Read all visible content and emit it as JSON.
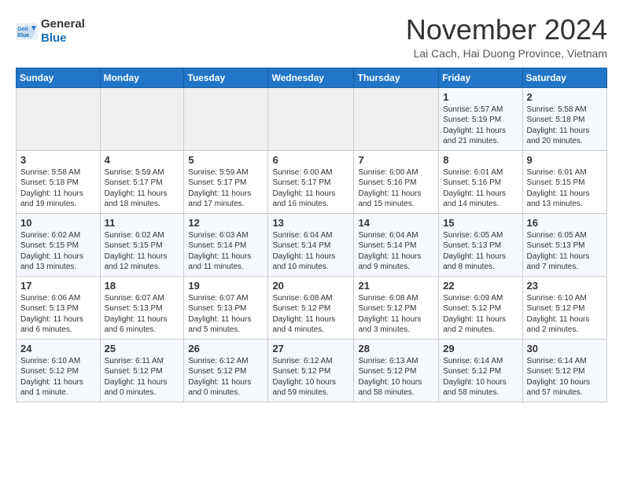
{
  "header": {
    "logo_general": "General",
    "logo_blue": "Blue",
    "month_title": "November 2024",
    "location": "Lai Cach, Hai Duong Province, Vietnam"
  },
  "weekdays": [
    "Sunday",
    "Monday",
    "Tuesday",
    "Wednesday",
    "Thursday",
    "Friday",
    "Saturday"
  ],
  "weeks": [
    [
      {
        "day": "",
        "info": ""
      },
      {
        "day": "",
        "info": ""
      },
      {
        "day": "",
        "info": ""
      },
      {
        "day": "",
        "info": ""
      },
      {
        "day": "",
        "info": ""
      },
      {
        "day": "1",
        "info": "Sunrise: 5:57 AM\nSunset: 5:19 PM\nDaylight: 11 hours\nand 21 minutes."
      },
      {
        "day": "2",
        "info": "Sunrise: 5:58 AM\nSunset: 5:18 PM\nDaylight: 11 hours\nand 20 minutes."
      }
    ],
    [
      {
        "day": "3",
        "info": "Sunrise: 5:58 AM\nSunset: 5:18 PM\nDaylight: 11 hours\nand 19 minutes."
      },
      {
        "day": "4",
        "info": "Sunrise: 5:59 AM\nSunset: 5:17 PM\nDaylight: 11 hours\nand 18 minutes."
      },
      {
        "day": "5",
        "info": "Sunrise: 5:59 AM\nSunset: 5:17 PM\nDaylight: 11 hours\nand 17 minutes."
      },
      {
        "day": "6",
        "info": "Sunrise: 6:00 AM\nSunset: 5:17 PM\nDaylight: 11 hours\nand 16 minutes."
      },
      {
        "day": "7",
        "info": "Sunrise: 6:00 AM\nSunset: 5:16 PM\nDaylight: 11 hours\nand 15 minutes."
      },
      {
        "day": "8",
        "info": "Sunrise: 6:01 AM\nSunset: 5:16 PM\nDaylight: 11 hours\nand 14 minutes."
      },
      {
        "day": "9",
        "info": "Sunrise: 6:01 AM\nSunset: 5:15 PM\nDaylight: 11 hours\nand 13 minutes."
      }
    ],
    [
      {
        "day": "10",
        "info": "Sunrise: 6:02 AM\nSunset: 5:15 PM\nDaylight: 11 hours\nand 13 minutes."
      },
      {
        "day": "11",
        "info": "Sunrise: 6:02 AM\nSunset: 5:15 PM\nDaylight: 11 hours\nand 12 minutes."
      },
      {
        "day": "12",
        "info": "Sunrise: 6:03 AM\nSunset: 5:14 PM\nDaylight: 11 hours\nand 11 minutes."
      },
      {
        "day": "13",
        "info": "Sunrise: 6:04 AM\nSunset: 5:14 PM\nDaylight: 11 hours\nand 10 minutes."
      },
      {
        "day": "14",
        "info": "Sunrise: 6:04 AM\nSunset: 5:14 PM\nDaylight: 11 hours\nand 9 minutes."
      },
      {
        "day": "15",
        "info": "Sunrise: 6:05 AM\nSunset: 5:13 PM\nDaylight: 11 hours\nand 8 minutes."
      },
      {
        "day": "16",
        "info": "Sunrise: 6:05 AM\nSunset: 5:13 PM\nDaylight: 11 hours\nand 7 minutes."
      }
    ],
    [
      {
        "day": "17",
        "info": "Sunrise: 6:06 AM\nSunset: 5:13 PM\nDaylight: 11 hours\nand 6 minutes."
      },
      {
        "day": "18",
        "info": "Sunrise: 6:07 AM\nSunset: 5:13 PM\nDaylight: 11 hours\nand 6 minutes."
      },
      {
        "day": "19",
        "info": "Sunrise: 6:07 AM\nSunset: 5:13 PM\nDaylight: 11 hours\nand 5 minutes."
      },
      {
        "day": "20",
        "info": "Sunrise: 6:08 AM\nSunset: 5:12 PM\nDaylight: 11 hours\nand 4 minutes."
      },
      {
        "day": "21",
        "info": "Sunrise: 6:08 AM\nSunset: 5:12 PM\nDaylight: 11 hours\nand 3 minutes."
      },
      {
        "day": "22",
        "info": "Sunrise: 6:09 AM\nSunset: 5:12 PM\nDaylight: 11 hours\nand 2 minutes."
      },
      {
        "day": "23",
        "info": "Sunrise: 6:10 AM\nSunset: 5:12 PM\nDaylight: 11 hours\nand 2 minutes."
      }
    ],
    [
      {
        "day": "24",
        "info": "Sunrise: 6:10 AM\nSunset: 5:12 PM\nDaylight: 11 hours\nand 1 minute."
      },
      {
        "day": "25",
        "info": "Sunrise: 6:11 AM\nSunset: 5:12 PM\nDaylight: 11 hours\nand 0 minutes."
      },
      {
        "day": "26",
        "info": "Sunrise: 6:12 AM\nSunset: 5:12 PM\nDaylight: 11 hours\nand 0 minutes."
      },
      {
        "day": "27",
        "info": "Sunrise: 6:12 AM\nSunset: 5:12 PM\nDaylight: 10 hours\nand 59 minutes."
      },
      {
        "day": "28",
        "info": "Sunrise: 6:13 AM\nSunset: 5:12 PM\nDaylight: 10 hours\nand 58 minutes."
      },
      {
        "day": "29",
        "info": "Sunrise: 6:14 AM\nSunset: 5:12 PM\nDaylight: 10 hours\nand 58 minutes."
      },
      {
        "day": "30",
        "info": "Sunrise: 6:14 AM\nSunset: 5:12 PM\nDaylight: 10 hours\nand 57 minutes."
      }
    ]
  ]
}
